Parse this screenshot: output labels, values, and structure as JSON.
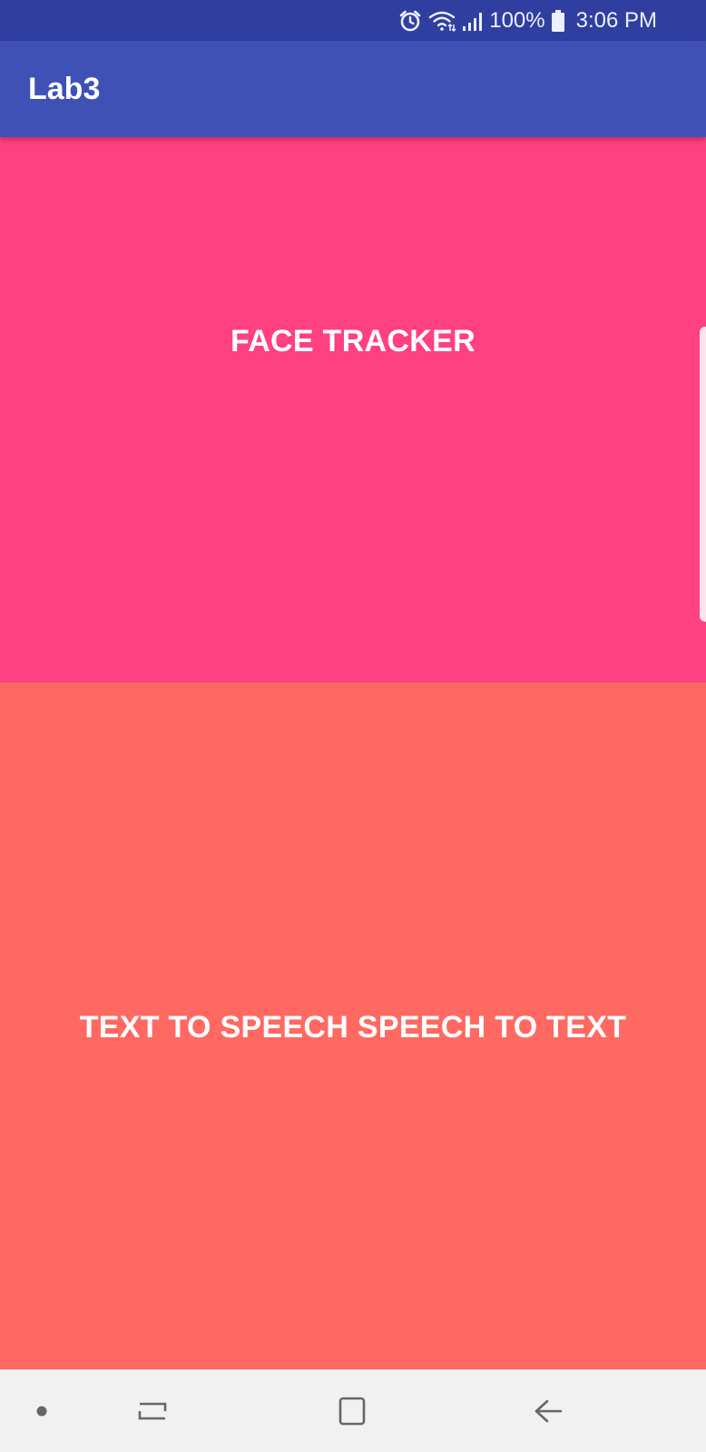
{
  "status_bar": {
    "battery_text": "100%",
    "time": "3:06 PM",
    "icons": [
      "alarm-icon",
      "wifi-icon",
      "signal-icon",
      "battery-icon"
    ]
  },
  "app_bar": {
    "title": "Lab3"
  },
  "main": {
    "face_tracker": {
      "label": "FACE TRACKER",
      "color": "#FF4081"
    },
    "tts_stt": {
      "label": "TEXT TO SPEECH SPEECH TO TEXT",
      "color": "#FF6961"
    }
  },
  "nav_bar": {
    "icons": [
      "nav-dot-icon",
      "recent-apps-icon",
      "home-icon",
      "back-icon"
    ]
  },
  "colors": {
    "status_bar": "#303F9F",
    "app_bar": "#3F51B5",
    "nav_bar": "#F1F1F1"
  }
}
